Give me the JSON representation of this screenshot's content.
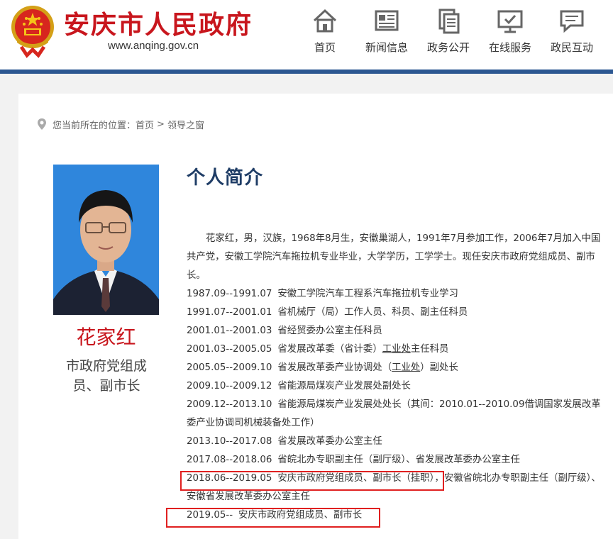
{
  "header": {
    "site_title": "安庆市人民政府",
    "site_url": "www.anqing.gov.cn",
    "nav": [
      {
        "label": "首页",
        "icon": "home-icon"
      },
      {
        "label": "新闻信息",
        "icon": "news-icon"
      },
      {
        "label": "政务公开",
        "icon": "documents-icon"
      },
      {
        "label": "在线服务",
        "icon": "monitor-icon"
      },
      {
        "label": "政民互动",
        "icon": "chat-icon"
      }
    ],
    "colors": {
      "brand_red": "#c8161d",
      "nav_rule": "#2c5791"
    }
  },
  "breadcrumb": {
    "prefix": "您当前所在的位置：",
    "items": [
      "首页",
      "领导之窗"
    ],
    "separator": ">"
  },
  "profile": {
    "name": "花家红",
    "title": "市政府党组成员、副市长"
  },
  "bio": {
    "heading": "个人简介",
    "intro": "花家红，男，汉族，1968年8月生，安徽巢湖人，1991年7月参加工作，2006年7月加入中国共产党，安徽工学院汽车拖拉机专业毕业，大学学历，工学学士。现任安庆市政府党组成员、副市长。",
    "timeline": [
      {
        "date": "1987.09--1991.07",
        "desc": "安徽工学院汽车工程系汽车拖拉机专业学习"
      },
      {
        "date": "1991.07--2001.01",
        "desc": "省机械厅（局）工作人员、科员、副主任科员"
      },
      {
        "date": "2001.01--2001.03",
        "desc": "省经贸委办公室主任科员"
      },
      {
        "date": "2001.03--2005.05",
        "desc_a": "省发展改革委（省计委）",
        "desc_u": "工业处",
        "desc_b": "主任科员"
      },
      {
        "date": "2005.05--2009.10",
        "desc_a": "省发展改革委产业协调处（",
        "desc_u": "工业处",
        "desc_b": "）副处长"
      },
      {
        "date": "2009.10--2009.12",
        "desc": "省能源局煤炭产业发展处副处长"
      },
      {
        "date": "2009.12--2013.10",
        "desc": "省能源局煤炭产业发展处处长（其间：2010.01--2010.09借调国家发展改革委产业协调司机械装备处工作）"
      },
      {
        "date": "2013.10--2017.08",
        "desc": "省发展改革委办公室主任"
      },
      {
        "date": "2017.08--2018.06",
        "desc": "省皖北办专职副主任（副厅级）、省发展改革委办公室主任"
      },
      {
        "date": "2018.06--2019.05",
        "desc": "安庆市政府党组成员、副市长（挂职），安徽省皖北办专职副主任（副厅级）、安徽省发展改革委办公室主任"
      },
      {
        "date": "2019.05--",
        "desc": "安庆市政府党组成员、副市长"
      }
    ]
  }
}
